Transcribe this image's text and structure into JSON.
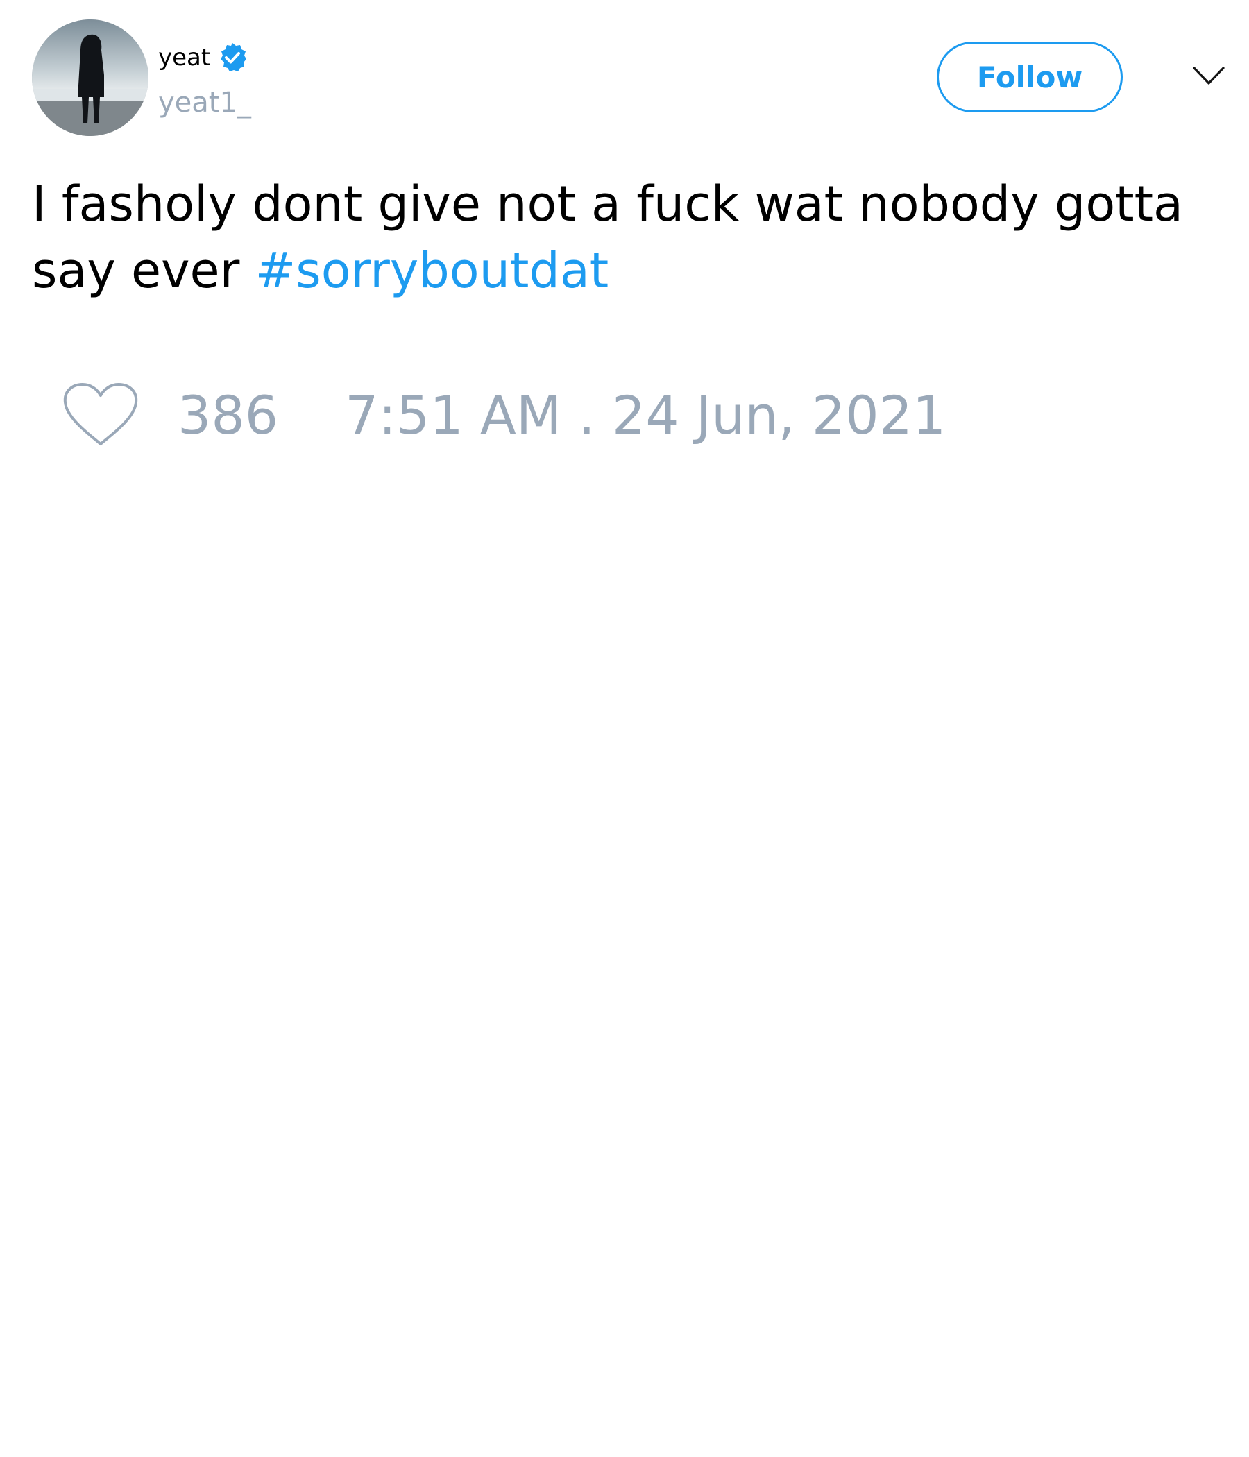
{
  "user": {
    "display_name": "yeat",
    "handle": "yeat1_",
    "verified": true
  },
  "header": {
    "follow_label": "Follow",
    "menu_icon": "chevron-down-icon"
  },
  "tweet": {
    "text": "I fasholy dont give not a fuck wat nobody gotta say ever ",
    "hashtag": "#sorryboutdat"
  },
  "footer": {
    "like_icon": "heart-icon",
    "like_count": "386",
    "timestamp": "7:51 AM . 24 Jun, 2021"
  },
  "colors": {
    "accent": "#1d9bf0",
    "muted": "#9aa8b8",
    "text": "#000000",
    "background": "#ffffff"
  }
}
